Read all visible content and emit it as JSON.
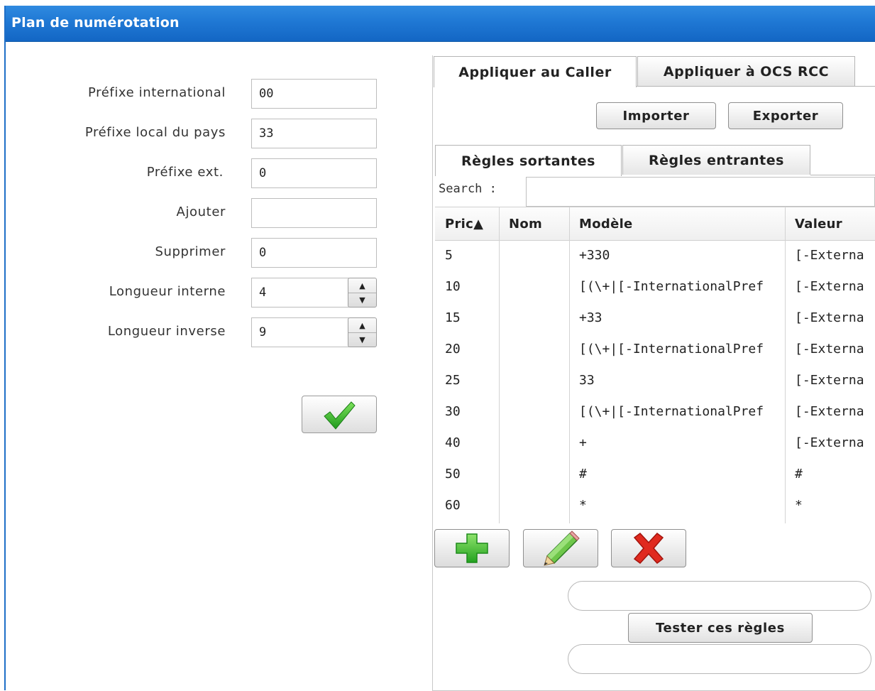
{
  "window": {
    "title": "Plan de numérotation"
  },
  "form": {
    "fields": [
      {
        "label": "Préfixe international",
        "value": "00"
      },
      {
        "label": "Préfixe local du pays",
        "value": "33"
      },
      {
        "label": "Préfixe ext.",
        "value": "0"
      },
      {
        "label": "Ajouter",
        "value": ""
      },
      {
        "label": "Supprimer",
        "value": "0"
      },
      {
        "label": "Longueur interne",
        "value": "4"
      },
      {
        "label": "Longueur inverse",
        "value": "9"
      }
    ],
    "apply_icon": "checkmark-icon"
  },
  "main_tabs": [
    {
      "label": "Appliquer au Caller",
      "active": true
    },
    {
      "label": "Appliquer à OCS RCC",
      "active": false
    }
  ],
  "actions": {
    "import_label": "Importer",
    "export_label": "Exporter"
  },
  "rule_tabs": [
    {
      "label": "Règles sortantes",
      "active": true
    },
    {
      "label": "Règles entrantes",
      "active": false
    }
  ],
  "search": {
    "label": "Search :",
    "value": ""
  },
  "table": {
    "columns": [
      "Pric▲",
      "Nom",
      "Modèle",
      "Valeur"
    ],
    "rows": [
      {
        "priority": "5",
        "name": "",
        "pattern": "+330",
        "value": "[-Externa"
      },
      {
        "priority": "10",
        "name": "",
        "pattern": "[(\\+|[-InternationalPref",
        "value": "[-Externa"
      },
      {
        "priority": "15",
        "name": "",
        "pattern": "+33",
        "value": "[-Externa"
      },
      {
        "priority": "20",
        "name": "",
        "pattern": "[(\\+|[-InternationalPref",
        "value": "[-Externa"
      },
      {
        "priority": "25",
        "name": "",
        "pattern": "33",
        "value": "[-Externa"
      },
      {
        "priority": "30",
        "name": "",
        "pattern": "[(\\+|[-InternationalPref",
        "value": "[-Externa"
      },
      {
        "priority": "40",
        "name": "",
        "pattern": "+",
        "value": "[-Externa"
      },
      {
        "priority": "50",
        "name": "",
        "pattern": "#",
        "value": "#"
      },
      {
        "priority": "60",
        "name": "",
        "pattern": "*",
        "value": "*"
      }
    ]
  },
  "row_actions": {
    "add_icon": "plus-icon",
    "edit_icon": "pencil-icon",
    "delete_icon": "delete-x-icon"
  },
  "test": {
    "button_label": "Tester ces règles",
    "input_value": "",
    "output_value": ""
  },
  "colors": {
    "title_bar": "#1f78d4",
    "add_green": "#3db83a",
    "delete_red": "#e02a1f",
    "check_green": "#2fae2a"
  }
}
